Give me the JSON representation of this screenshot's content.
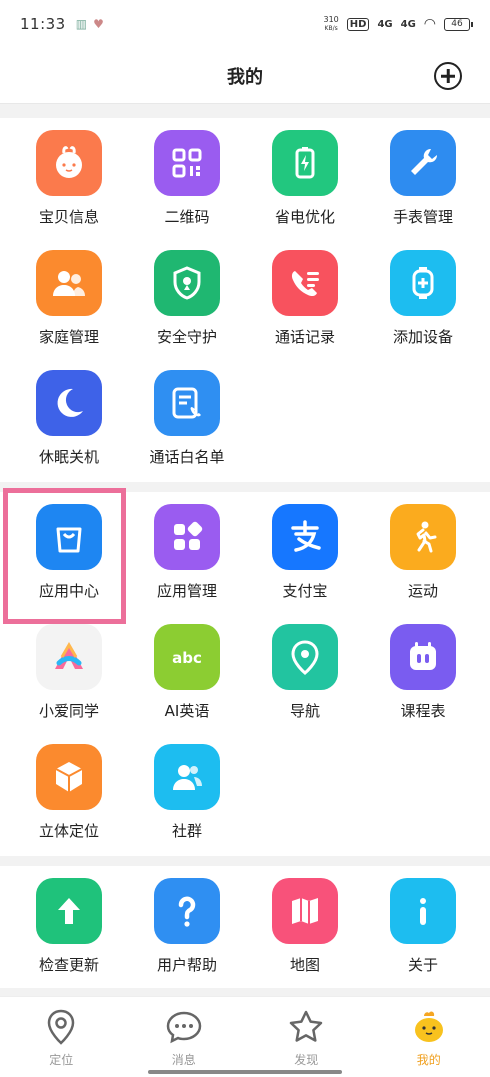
{
  "status_bar": {
    "time": "11:33",
    "net_speed_value": "310",
    "net_speed_unit": "KB/s",
    "hd": "HD",
    "sig1": "4G",
    "sig2": "4G",
    "battery": "46"
  },
  "header": {
    "title": "我的"
  },
  "colors": {
    "accent": "#f0a020",
    "highlight": "#ec6f9a"
  },
  "sections": [
    {
      "items": [
        {
          "label": "宝贝信息",
          "icon": "baby-face-icon",
          "color": "#fb7a4c"
        },
        {
          "label": "二维码",
          "icon": "qr-code-icon",
          "color": "#9a5cf0"
        },
        {
          "label": "省电优化",
          "icon": "battery-saver-icon",
          "color": "#22c77f"
        },
        {
          "label": "手表管理",
          "icon": "wrench-icon",
          "color": "#2e8cf0"
        },
        {
          "label": "家庭管理",
          "icon": "family-icon",
          "color": "#fb8a2e"
        },
        {
          "label": "安全守护",
          "icon": "shield-icon",
          "color": "#1fb771"
        },
        {
          "label": "通话记录",
          "icon": "call-log-icon",
          "color": "#f8525e"
        },
        {
          "label": "添加设备",
          "icon": "add-device-icon",
          "color": "#1dbdf0"
        },
        {
          "label": "休眠关机",
          "icon": "moon-icon",
          "color": "#3e62e8"
        },
        {
          "label": "通话白名单",
          "icon": "whitelist-icon",
          "color": "#2f8ff2"
        }
      ]
    },
    {
      "items": [
        {
          "label": "应用中心",
          "icon": "shopping-bag-icon",
          "color": "#1e86f2"
        },
        {
          "label": "应用管理",
          "icon": "apps-grid-icon",
          "color": "#9a5cf0"
        },
        {
          "label": "支付宝",
          "icon": "alipay-icon",
          "color": "#1677ff"
        },
        {
          "label": "运动",
          "icon": "running-icon",
          "color": "#fbab1e"
        },
        {
          "label": "小爱同学",
          "icon": "xiaoai-icon",
          "color": "#f3f3f3"
        },
        {
          "label": "AI英语",
          "icon": "abc-icon",
          "color": "#8ccd32"
        },
        {
          "label": "导航",
          "icon": "location-pin-icon",
          "color": "#22c4a0"
        },
        {
          "label": "课程表",
          "icon": "schedule-icon",
          "color": "#7a5cf0"
        },
        {
          "label": "立体定位",
          "icon": "cube-icon",
          "color": "#fb8a2e"
        },
        {
          "label": "社群",
          "icon": "community-icon",
          "color": "#1dbdf0"
        }
      ]
    },
    {
      "items": [
        {
          "label": "检查更新",
          "icon": "arrow-up-icon",
          "color": "#1fc27b"
        },
        {
          "label": "用户帮助",
          "icon": "question-icon",
          "color": "#2f8ff2"
        },
        {
          "label": "地图",
          "icon": "map-icon",
          "color": "#f8527a"
        },
        {
          "label": "关于",
          "icon": "info-icon",
          "color": "#1dbdf0"
        }
      ]
    }
  ],
  "tabs": [
    {
      "label": "定位",
      "icon": "location-tab-icon",
      "active": false
    },
    {
      "label": "消息",
      "icon": "message-tab-icon",
      "active": false
    },
    {
      "label": "发现",
      "icon": "star-tab-icon",
      "active": false
    },
    {
      "label": "我的",
      "icon": "mascot-tab-icon",
      "active": true
    }
  ]
}
